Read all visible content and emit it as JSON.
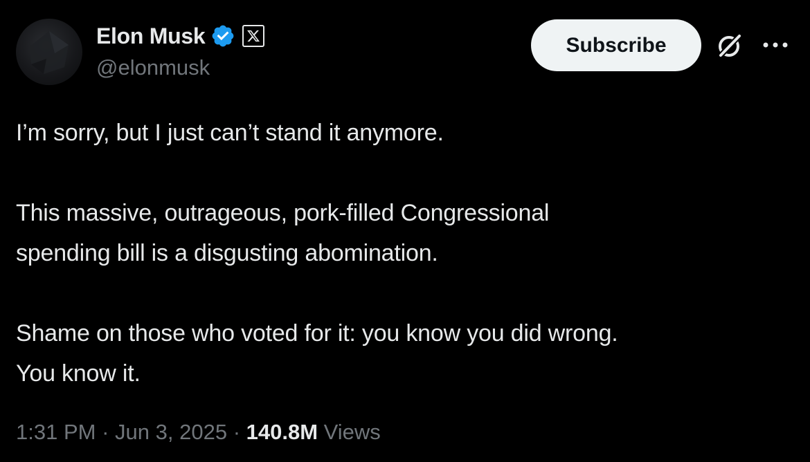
{
  "header": {
    "display_name": "Elon Musk",
    "handle": "@elonmusk",
    "subscribe_label": "Subscribe",
    "verified_color": "#1d9bf0",
    "icons": {
      "verified": "verified-badge-icon",
      "affiliation": "x-logo-icon",
      "grok": "grok-icon",
      "more": "more-icon"
    }
  },
  "tweet": {
    "line1": "I’m sorry, but I just can’t stand it anymore.",
    "line2": "This massive, outrageous, pork-filled Congressional",
    "line3": "spending bill is a disgusting abomination.",
    "line4": "Shame on those who voted for it: you know you did wrong.",
    "line5": "You know it."
  },
  "meta": {
    "time": "1:31 PM",
    "separator": "·",
    "date": "Jun 3, 2025",
    "views_count": "140.8M",
    "views_label": "Views"
  }
}
